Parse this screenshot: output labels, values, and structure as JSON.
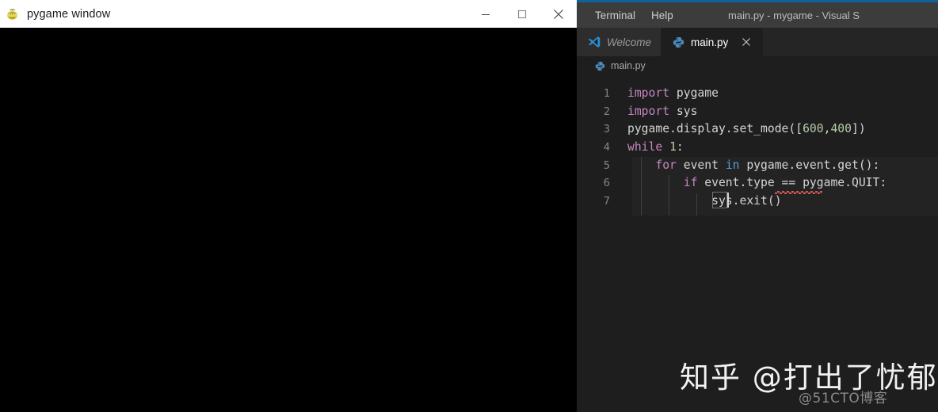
{
  "pygame_window": {
    "title": "pygame window",
    "icon": "pygame-snake-icon",
    "controls": {
      "minimize": "minimize-icon",
      "maximize": "maximize-icon",
      "close": "close-icon"
    },
    "canvas_color": "#000000",
    "titlebar_color": "#ffffff"
  },
  "vscode": {
    "window_title": "main.py - mygame - Visual S",
    "menu": [
      {
        "label": "Terminal"
      },
      {
        "label": "Help"
      }
    ],
    "tabs": [
      {
        "label": "Welcome",
        "icon": "vscode-logo-icon",
        "active": false,
        "italic": true
      },
      {
        "label": "main.py",
        "icon": "python-icon",
        "active": true,
        "close": "close-icon"
      }
    ],
    "breadcrumb": {
      "label": "main.py",
      "icon": "python-icon"
    },
    "editor": {
      "lines": [
        {
          "n": "1",
          "text": "import pygame"
        },
        {
          "n": "2",
          "text": "import sys"
        },
        {
          "n": "3",
          "text": "pygame.display.set_mode([600,400])"
        },
        {
          "n": "4",
          "text": "while 1:"
        },
        {
          "n": "5",
          "text": "    for event in pygame.event.get():"
        },
        {
          "n": "6",
          "text": "        if event.type == pygame.QUIT:"
        },
        {
          "n": "7",
          "text": "            sys.exit()"
        }
      ],
      "colors": {
        "background": "#1e1e1e",
        "foreground": "#d4d4d4",
        "keyword": "#c586c0",
        "builtin": "#569cd6",
        "number": "#b5cea8",
        "line_number": "#858585",
        "error_squiggle": "#e05a5a"
      }
    }
  },
  "watermarks": {
    "primary": "知乎 @打出了忧郁",
    "secondary": "@51CTO博客"
  }
}
